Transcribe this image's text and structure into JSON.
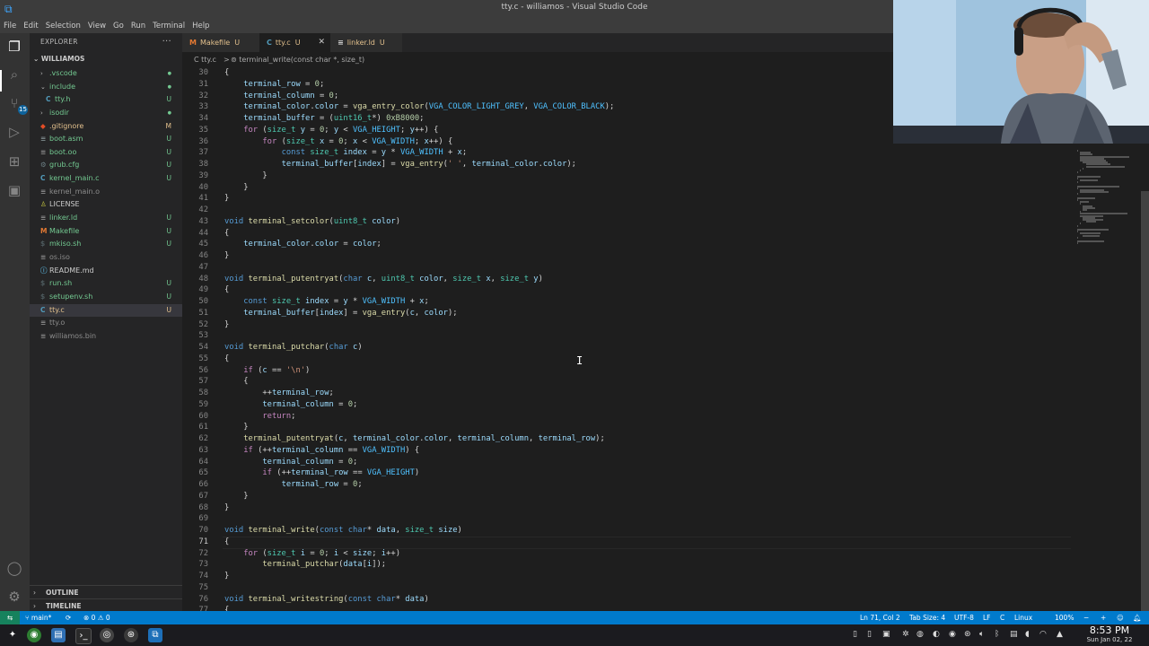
{
  "window": {
    "title": "tty.c - williamos - Visual Studio Code"
  },
  "menu": [
    "File",
    "Edit",
    "Selection",
    "View",
    "Go",
    "Run",
    "Terminal",
    "Help"
  ],
  "activity_bar": {
    "scm_badge": "15"
  },
  "explorer": {
    "header": "EXPLORER",
    "more": "···",
    "root": "WILLIAMOS",
    "items": [
      {
        "name": ".vscode",
        "kind": "folder",
        "depth": 1,
        "status": "",
        "color": "#73c991"
      },
      {
        "name": "include",
        "kind": "folder-open",
        "depth": 1,
        "status": "",
        "color": "#73c991"
      },
      {
        "name": "tty.h",
        "kind": "c",
        "depth": 2,
        "status": "U",
        "color": "#73c991"
      },
      {
        "name": "isodir",
        "kind": "folder",
        "depth": 1,
        "status": "",
        "color": "#73c991"
      },
      {
        "name": ".gitignore",
        "kind": "git",
        "depth": 1,
        "status": "M",
        "color": "#e2c08d"
      },
      {
        "name": "boot.asm",
        "kind": "asm",
        "depth": 1,
        "status": "U",
        "color": "#73c991"
      },
      {
        "name": "boot.oo",
        "kind": "file",
        "depth": 1,
        "status": "U",
        "color": "#73c991"
      },
      {
        "name": "grub.cfg",
        "kind": "gear",
        "depth": 1,
        "status": "U",
        "color": "#73c991"
      },
      {
        "name": "kernel_main.c",
        "kind": "c",
        "depth": 1,
        "status": "U",
        "color": "#73c991"
      },
      {
        "name": "kernel_main.o",
        "kind": "file",
        "depth": 1,
        "status": "",
        "color": "#8c8c8c"
      },
      {
        "name": "LICENSE",
        "kind": "license",
        "depth": 1,
        "status": "",
        "color": "#cccccc"
      },
      {
        "name": "linker.ld",
        "kind": "lines",
        "depth": 1,
        "status": "U",
        "color": "#73c991"
      },
      {
        "name": "Makefile",
        "kind": "make",
        "depth": 1,
        "status": "U",
        "color": "#73c991"
      },
      {
        "name": "mkiso.sh",
        "kind": "shell",
        "depth": 1,
        "status": "U",
        "color": "#73c991"
      },
      {
        "name": "os.iso",
        "kind": "file",
        "depth": 1,
        "status": "",
        "color": "#8c8c8c"
      },
      {
        "name": "README.md",
        "kind": "info",
        "depth": 1,
        "status": "",
        "color": "#cccccc"
      },
      {
        "name": "run.sh",
        "kind": "shell",
        "depth": 1,
        "status": "U",
        "color": "#73c991"
      },
      {
        "name": "setupenv.sh",
        "kind": "shell",
        "depth": 1,
        "status": "U",
        "color": "#73c991"
      },
      {
        "name": "tty.c",
        "kind": "c",
        "depth": 1,
        "status": "U",
        "color": "#e2c08d",
        "selected": true
      },
      {
        "name": "tty.o",
        "kind": "file",
        "depth": 1,
        "status": "",
        "color": "#8c8c8c"
      },
      {
        "name": "williamos.bin",
        "kind": "lines",
        "depth": 1,
        "status": "",
        "color": "#8c8c8c"
      }
    ],
    "outline": "OUTLINE",
    "timeline": "TIMELINE"
  },
  "tabs": [
    {
      "icon": "M",
      "icon_color": "#e37933",
      "label": "Makefile",
      "status": "U",
      "active": false
    },
    {
      "icon": "C",
      "icon_color": "#519aba",
      "label": "tty.c",
      "status": "U",
      "active": true
    },
    {
      "icon": "≡",
      "icon_color": "#cccccc",
      "label": "linker.ld",
      "status": "U",
      "active": false
    }
  ],
  "breadcrumb": {
    "file": "C tty.c",
    "sep": ">",
    "symbol": "⊚ terminal_write(const char *, size_t)"
  },
  "editor": {
    "current_line": 71,
    "lines": [
      {
        "n": 30,
        "t": "{"
      },
      {
        "n": 31,
        "t": "    terminal_row = 0;"
      },
      {
        "n": 32,
        "t": "    terminal_column = 0;"
      },
      {
        "n": 33,
        "t": "    terminal_color.color = vga_entry_color(VGA_COLOR_LIGHT_GREY, VGA_COLOR_BLACK);"
      },
      {
        "n": 34,
        "t": "    terminal_buffer = (uint16_t*) 0xB8000;"
      },
      {
        "n": 35,
        "t": "    for (size_t y = 0; y < VGA_HEIGHT; y++) {"
      },
      {
        "n": 36,
        "t": "        for (size_t x = 0; x < VGA_WIDTH; x++) {"
      },
      {
        "n": 37,
        "t": "            const size_t index = y * VGA_WIDTH + x;"
      },
      {
        "n": 38,
        "t": "            terminal_buffer[index] = vga_entry(' ', terminal_color.color);"
      },
      {
        "n": 39,
        "t": "        }"
      },
      {
        "n": 40,
        "t": "    }"
      },
      {
        "n": 41,
        "t": "}"
      },
      {
        "n": 42,
        "t": ""
      },
      {
        "n": 43,
        "t": "void terminal_setcolor(uint8_t color)"
      },
      {
        "n": 44,
        "t": "{"
      },
      {
        "n": 45,
        "t": "    terminal_color.color = color;"
      },
      {
        "n": 46,
        "t": "}"
      },
      {
        "n": 47,
        "t": ""
      },
      {
        "n": 48,
        "t": "void terminal_putentryat(char c, uint8_t color, size_t x, size_t y)"
      },
      {
        "n": 49,
        "t": "{"
      },
      {
        "n": 50,
        "t": "    const size_t index = y * VGA_WIDTH + x;"
      },
      {
        "n": 51,
        "t": "    terminal_buffer[index] = vga_entry(c, color);"
      },
      {
        "n": 52,
        "t": "}"
      },
      {
        "n": 53,
        "t": ""
      },
      {
        "n": 54,
        "t": "void terminal_putchar(char c)"
      },
      {
        "n": 55,
        "t": "{"
      },
      {
        "n": 56,
        "t": "    if (c == '\\n')"
      },
      {
        "n": 57,
        "t": "    {"
      },
      {
        "n": 58,
        "t": "        ++terminal_row;"
      },
      {
        "n": 59,
        "t": "        terminal_column = 0;"
      },
      {
        "n": 60,
        "t": "        return;"
      },
      {
        "n": 61,
        "t": "    }"
      },
      {
        "n": 62,
        "t": "    terminal_putentryat(c, terminal_color.color, terminal_column, terminal_row);"
      },
      {
        "n": 63,
        "t": "    if (++terminal_column == VGA_WIDTH) {"
      },
      {
        "n": 64,
        "t": "        terminal_column = 0;"
      },
      {
        "n": 65,
        "t": "        if (++terminal_row == VGA_HEIGHT)"
      },
      {
        "n": 66,
        "t": "            terminal_row = 0;"
      },
      {
        "n": 67,
        "t": "    }"
      },
      {
        "n": 68,
        "t": "}"
      },
      {
        "n": 69,
        "t": ""
      },
      {
        "n": 70,
        "t": "void terminal_write(const char* data, size_t size)"
      },
      {
        "n": 71,
        "t": "{"
      },
      {
        "n": 72,
        "t": "    for (size_t i = 0; i < size; i++)"
      },
      {
        "n": 73,
        "t": "        terminal_putchar(data[i]);"
      },
      {
        "n": 74,
        "t": "}"
      },
      {
        "n": 75,
        "t": ""
      },
      {
        "n": 76,
        "t": "void terminal_writestring(const char* data)"
      },
      {
        "n": 77,
        "t": "{"
      }
    ]
  },
  "statusbar": {
    "branch": "main*",
    "errors": "⊗ 0 ⚠ 0",
    "position": "Ln 71, Col 2",
    "tab_size": "Tab Size: 4",
    "encoding": "UTF-8",
    "eol": "LF",
    "language": "C",
    "platform": "Linux",
    "zoom": "100%"
  },
  "taskbar": {
    "time": "8:53 PM",
    "date": "Sun Jan 02, 22"
  }
}
